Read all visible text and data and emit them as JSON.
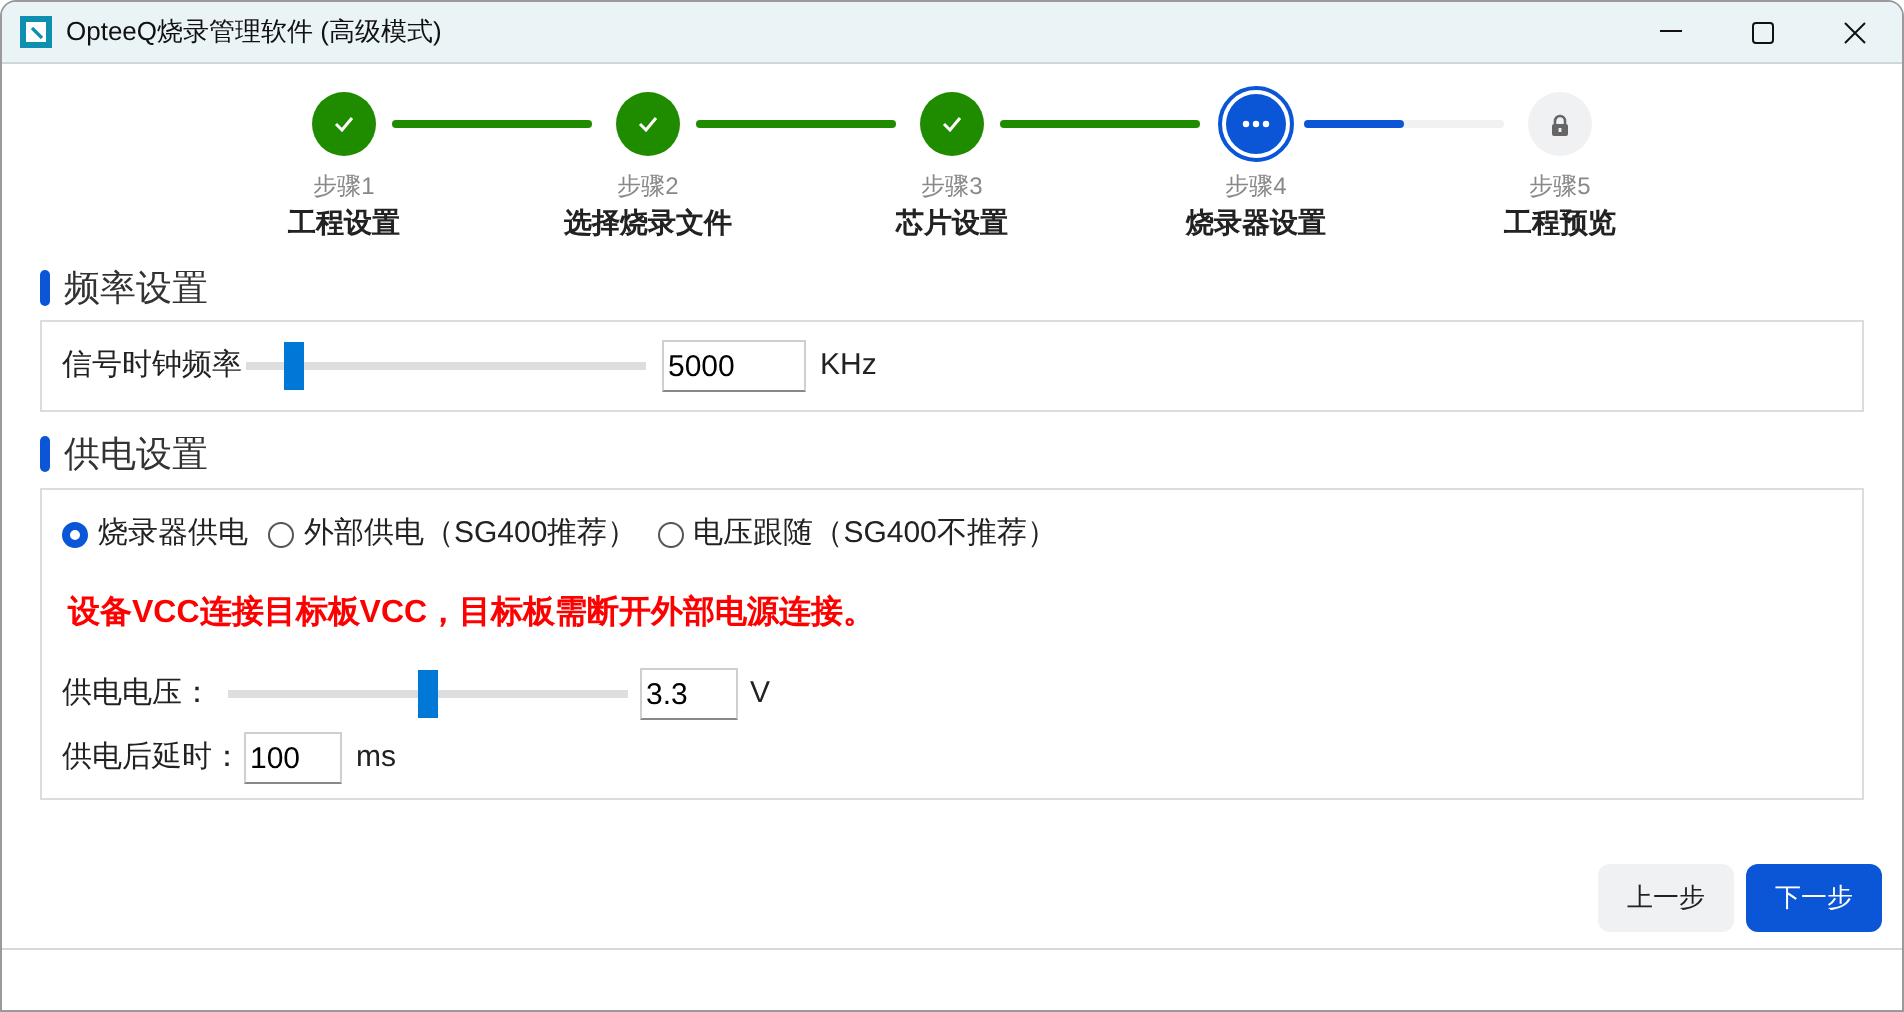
{
  "window": {
    "title": "OpteeQ烧录管理软件 (高级模式)"
  },
  "steps": [
    {
      "caption": "步骤1",
      "title": "工程设置",
      "kind": "done",
      "connector": {
        "level": 1
      }
    },
    {
      "caption": "步骤2",
      "title": "选择烧录文件",
      "kind": "done",
      "connector": {
        "level": 1
      }
    },
    {
      "caption": "步骤3",
      "title": "芯片设置",
      "kind": "done",
      "connector": {
        "level": 1
      }
    },
    {
      "caption": "步骤4",
      "title": "烧录器设置",
      "kind": "active",
      "connector": {
        "level": 0.5
      }
    },
    {
      "caption": "步骤5",
      "title": "工程预览",
      "kind": "locked"
    }
  ],
  "frequency": {
    "heading": "频率设置",
    "label": "信号时钟频率",
    "level": 0.12,
    "value": "5000",
    "unit": "KHz"
  },
  "power": {
    "heading": "供电设置",
    "options": [
      {
        "label": "烧录器供电",
        "selected": true
      },
      {
        "label": "外部供电（SG400推荐）",
        "selected": false
      },
      {
        "label": "电压跟随（SG400不推荐）",
        "selected": false
      }
    ],
    "warning": "设备VCC连接目标板VCC，目标板需断开外部电源连接。",
    "voltage": {
      "label": "供电电压：",
      "level": 0.5,
      "value": "3.3",
      "unit": "V"
    },
    "delay": {
      "label": "供电后延时：",
      "value": "100",
      "unit": "ms"
    }
  },
  "buttons": [
    {
      "label": "上一步",
      "kind": "secondary"
    },
    {
      "label": "下一步",
      "kind": "primary"
    }
  ]
}
